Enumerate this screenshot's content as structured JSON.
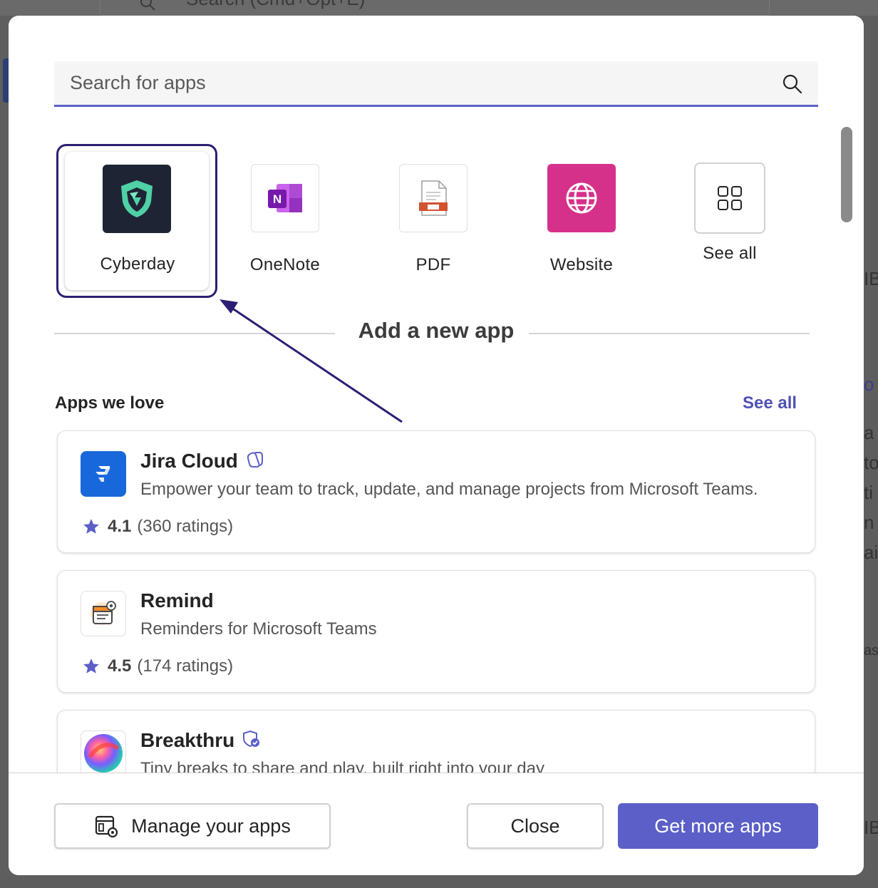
{
  "background": {
    "search_text": "Search (Cmd+Opt+E)",
    "right_fragments": [
      "IB",
      "o",
      "a -",
      "to",
      "ti",
      "n",
      "ai",
      "as",
      "IB"
    ]
  },
  "search": {
    "placeholder": "Search for apps"
  },
  "recent_apps": [
    {
      "label": "Cyberday",
      "icon": "cyberday-logo"
    },
    {
      "label": "OneNote",
      "icon": "onenote-logo"
    },
    {
      "label": "PDF",
      "icon": "pdf-icon"
    },
    {
      "label": "Website",
      "icon": "globe-icon"
    },
    {
      "label": "See all",
      "icon": "grid-icon"
    }
  ],
  "divider_text": "Add a new app",
  "section": {
    "title": "Apps we love",
    "see_all": "See all"
  },
  "apps": [
    {
      "name": "Jira Cloud",
      "description": "Empower your team to track, update, and manage projects from Microsoft Teams.",
      "rating": "4.1",
      "ratings_count": "(360 ratings)",
      "badge": "copilot-icon"
    },
    {
      "name": "Remind",
      "description": "Reminders for Microsoft Teams",
      "rating": "4.5",
      "ratings_count": "(174 ratings)"
    },
    {
      "name": "Breakthru",
      "description": "Tiny breaks to share and play, built right into your day",
      "badge": "verified-shield-icon"
    }
  ],
  "footer": {
    "manage_label": "Manage your apps",
    "close_label": "Close",
    "get_more_label": "Get more apps"
  },
  "colors": {
    "accent": "#5b5fc7",
    "highlight": "#2c1f73",
    "link": "#4f52b2"
  }
}
